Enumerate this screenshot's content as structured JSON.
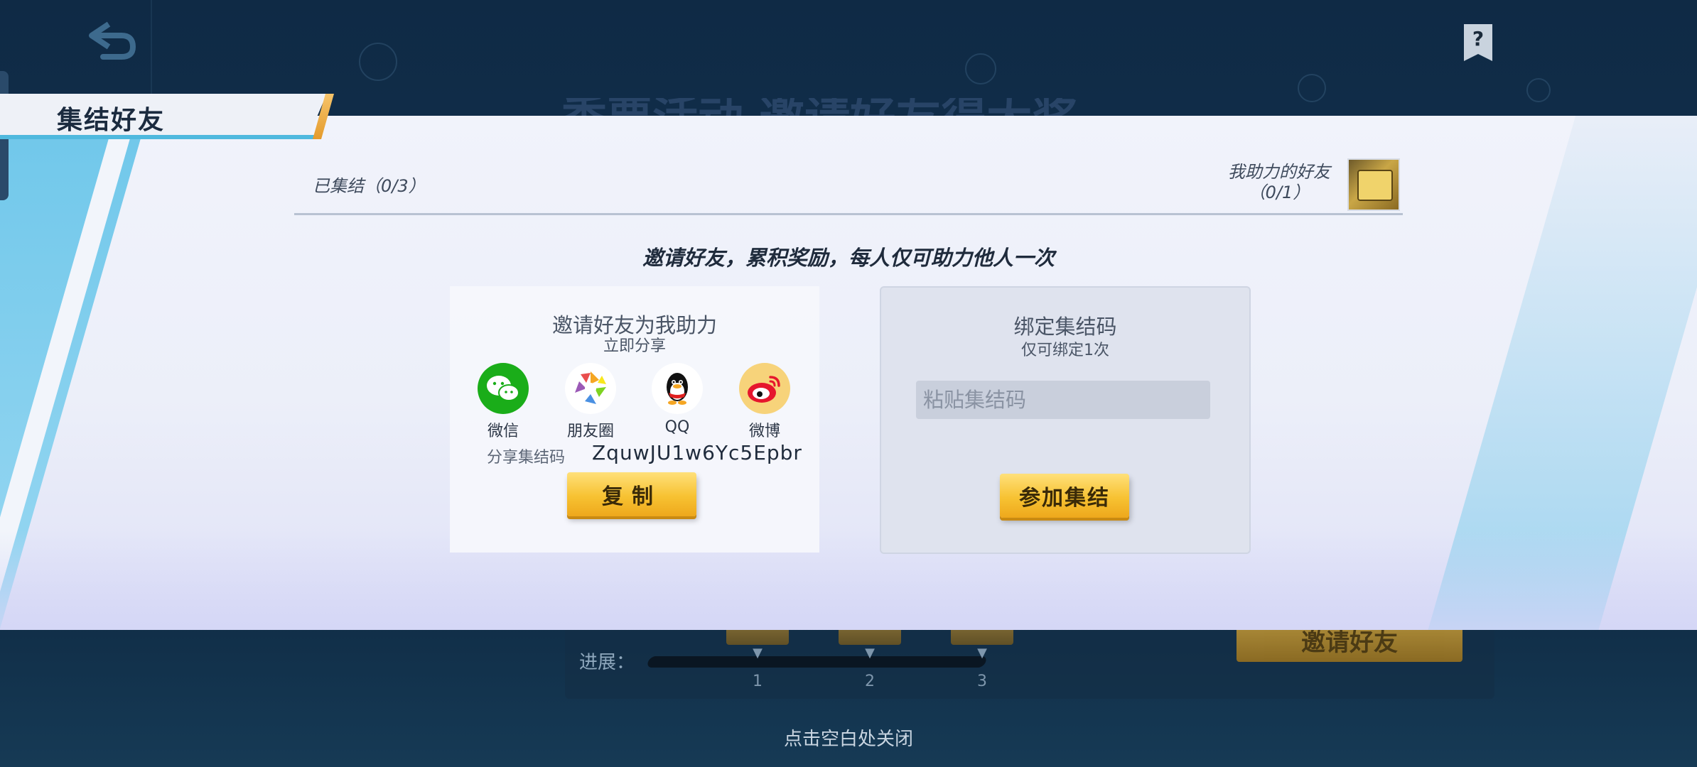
{
  "background": {
    "title_partial": "季票活动 邀请好友得大奖",
    "progress_label": "进展：",
    "milestones": [
      "1",
      "2",
      "3"
    ],
    "invite_button": "邀请好友",
    "close_hint": "点击空白处关闭",
    "progress_fraction": 0
  },
  "header": {
    "title": "集结好友"
  },
  "status": {
    "gathered": "已集结（0/3）",
    "helped_title": "我助力的好友",
    "helped_count": "（0/1）"
  },
  "subtitle": "邀请好友，累积奖励，每人仅可助力他人一次",
  "invite": {
    "title": "邀请好友为我助力",
    "subtitle": "立即分享",
    "share_targets": [
      {
        "label": "微信",
        "icon": "wechat-icon",
        "color": "#1aad19"
      },
      {
        "label": "朋友圈",
        "icon": "moments-icon",
        "color": "#ffffff"
      },
      {
        "label": "QQ",
        "icon": "qq-icon",
        "color": "#ffffff"
      },
      {
        "label": "微博",
        "icon": "weibo-icon",
        "color": "#f7d37a"
      }
    ],
    "code_label": "分享集结码",
    "code_value": "ZquwJU1w6Yc5Epbr",
    "copy_button": "复制"
  },
  "bind": {
    "title": "绑定集结码",
    "subtitle": "仅可绑定1次",
    "input_placeholder": "粘贴集结码",
    "input_value": "",
    "join_button": "参加集结"
  },
  "colors": {
    "accent_yellow": "#f7c232",
    "header_stripe": "#4fb9de",
    "background_dark": "#0f2a45"
  }
}
